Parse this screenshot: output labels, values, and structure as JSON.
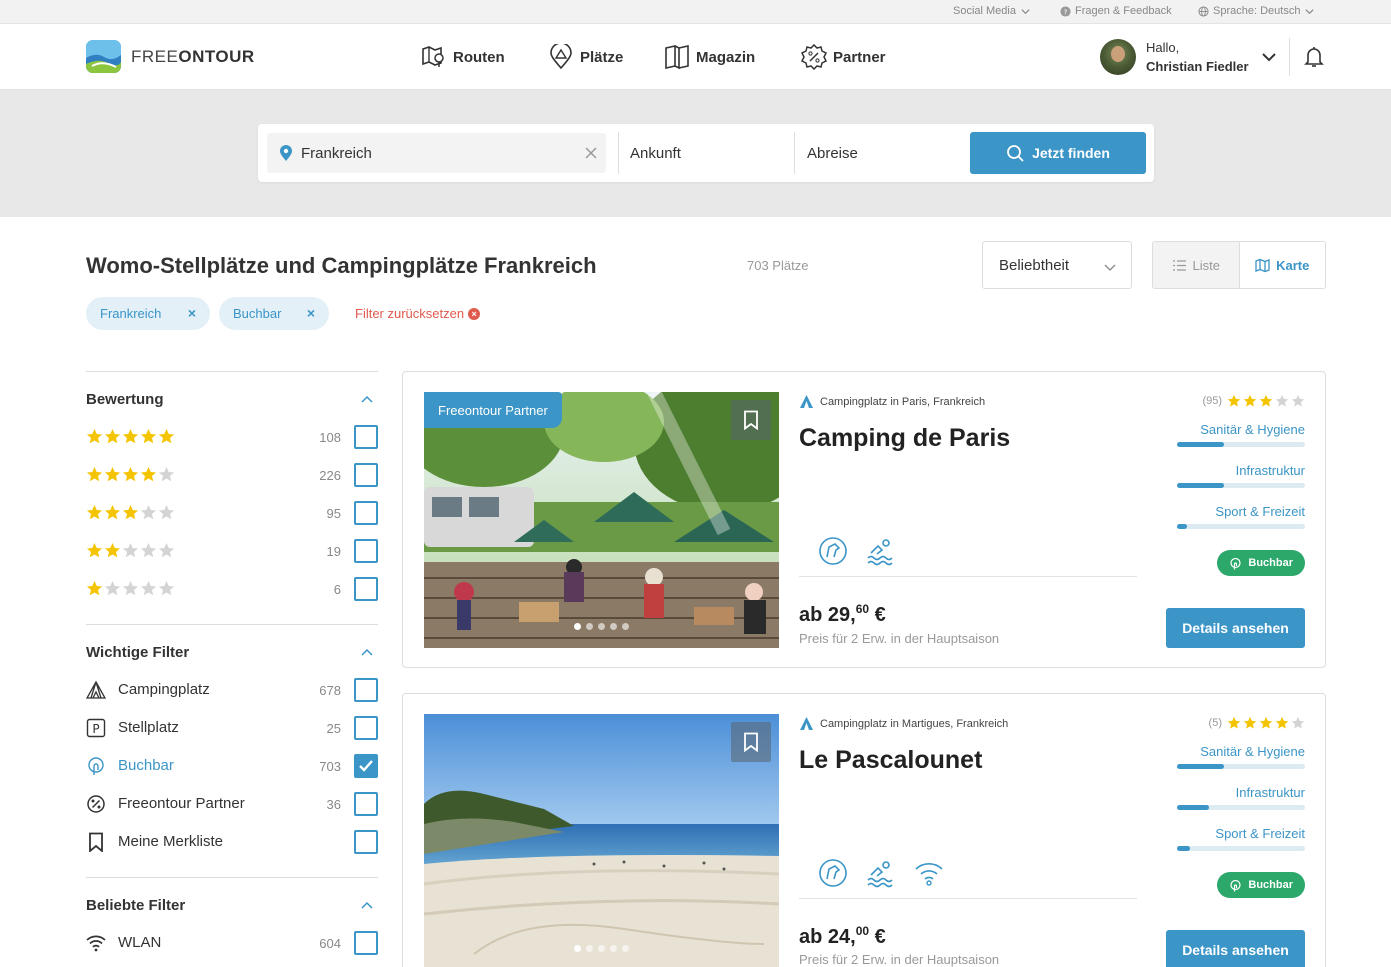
{
  "colors": {
    "accent": "#3b95c7",
    "star": "#f5c400",
    "success": "#2ba86a",
    "danger": "#e05a4e"
  },
  "topbar": {
    "social": "Social Media",
    "feedback": "Fragen & Feedback",
    "language": "Sprache: Deutsch"
  },
  "header": {
    "logo_light": "FREE",
    "logo_bold": "ONTOUR",
    "nav": [
      {
        "label": "Routen",
        "icon": "route-map-icon"
      },
      {
        "label": "Plätze",
        "icon": "tent-pin-icon"
      },
      {
        "label": "Magazin",
        "icon": "book-icon"
      },
      {
        "label": "Partner",
        "icon": "percent-badge-icon"
      }
    ],
    "greeting": "Hallo,",
    "user_name": "Christian Fiedler"
  },
  "search": {
    "location_value": "Frankreich",
    "arrival": "Ankunft",
    "departure": "Abreise",
    "button": "Jetzt finden"
  },
  "results": {
    "title": "Womo-Stellplätze und Campingplätze Frankreich",
    "count": "703 Plätze",
    "sort": "Beliebtheit",
    "view_list": "Liste",
    "view_map": "Karte",
    "chips": [
      "Frankreich",
      "Buchbar"
    ],
    "chip_remove": "×",
    "reset": "Filter zurücksetzen",
    "reset_icon": "×"
  },
  "sidebar": {
    "rating": {
      "title": "Bewertung",
      "rows": [
        {
          "stars": 5,
          "count": "108"
        },
        {
          "stars": 4,
          "count": "226"
        },
        {
          "stars": 3,
          "count": "95"
        },
        {
          "stars": 2,
          "count": "19"
        },
        {
          "stars": 1,
          "count": "6"
        }
      ]
    },
    "important": {
      "title": "Wichtige Filter",
      "rows": [
        {
          "label": "Campingplatz",
          "count": "678",
          "checked": false,
          "icon": "tent-icon"
        },
        {
          "label": "Stellplatz",
          "count": "25",
          "checked": false,
          "icon": "parking-icon"
        },
        {
          "label": "Buchbar",
          "count": "703",
          "checked": true,
          "icon": "bookable-icon"
        },
        {
          "label": "Freeontour Partner",
          "count": "36",
          "checked": false,
          "icon": "percent-badge-icon"
        },
        {
          "label": "Meine Merkliste",
          "count": "",
          "checked": false,
          "icon": "bookmark-icon"
        }
      ]
    },
    "popular": {
      "title": "Beliebte Filter",
      "rows": [
        {
          "label": "WLAN",
          "count": "604",
          "checked": false,
          "icon": "wifi-icon"
        }
      ]
    }
  },
  "cards": [
    {
      "partner_label": "Freeontour Partner",
      "type": "Campingplatz in Paris, Frankreich",
      "title": "Camping de Paris",
      "rating_count": "(95)",
      "rating": 3,
      "scores": [
        {
          "label": "Sanitär & Hygiene",
          "value": 0.37
        },
        {
          "label": "Infrastruktur",
          "value": 0.37
        },
        {
          "label": "Sport & Freizeit",
          "value": 0.08
        }
      ],
      "badge": "Buchbar",
      "price_prefix": "ab 29,",
      "price_cents": "60",
      "price_suffix": " €",
      "price_note": "Preis für 2 Erw. in der Hauptsaison",
      "button": "Details ansehen"
    },
    {
      "partner_label": "",
      "type": "Campingplatz in Martigues, Frankreich",
      "title": "Le Pascalounet",
      "rating_count": "(5)",
      "rating": 4,
      "scores": [
        {
          "label": "Sanitär & Hygiene",
          "value": 0.37
        },
        {
          "label": "Infrastruktur",
          "value": 0.25
        },
        {
          "label": "Sport & Freizeit",
          "value": 0.1
        }
      ],
      "badge": "Buchbar",
      "price_prefix": "ab 24,",
      "price_cents": "00",
      "price_suffix": " €",
      "price_note": "Preis für 2 Erw. in der Hauptsaison",
      "button": "Details ansehen"
    }
  ]
}
